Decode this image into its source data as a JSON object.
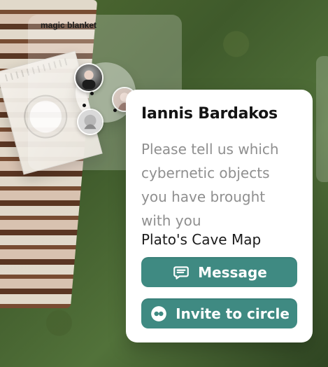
{
  "panel": {
    "title": "magic blanket"
  },
  "card": {
    "name": "Iannis Bardakos",
    "prompt": "Please tell us which cybernetic objects you have brought with you",
    "answer": "Plato's Cave Map",
    "actions": [
      {
        "label": "Message",
        "icon": "message-icon"
      },
      {
        "label": "Invite to circle",
        "icon": "invite-icon"
      }
    ]
  },
  "colors": {
    "button_teal": "#3f8a82",
    "card_bg": "#ffffff",
    "name_text": "#141414",
    "prompt_text": "#8f8f8f"
  }
}
